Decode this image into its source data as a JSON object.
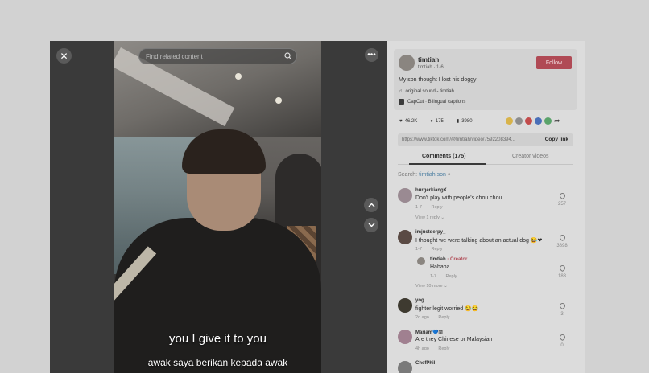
{
  "video": {
    "search_placeholder": "Find related content",
    "caption_en": "you I give it to you",
    "caption_ms": "awak saya berikan kepada awak"
  },
  "author": {
    "username": "timtiah",
    "subline": "timtiah · 1-6",
    "follow_label": "Follow",
    "description": "My son thought I lost his doggy",
    "sound": "original sound - timtiah",
    "capcut": "CapCut · Bilingual captions"
  },
  "stats": {
    "likes": "46.2K",
    "comments": "175",
    "saves": "3980"
  },
  "share_colors": [
    "#d8b34a",
    "#8d8d8d",
    "#c24b4b",
    "#4a6fb8",
    "#5aa36a",
    "#444444"
  ],
  "link": {
    "url": "https://www.tiktok.com/@timtiah/video/75922083​94...",
    "copy_label": "Copy link"
  },
  "tabs": {
    "comments": "Comments (175)",
    "creator": "Creator videos"
  },
  "search": {
    "label": "Search:",
    "query": "timtiah son"
  },
  "comments": [
    {
      "name": "burgerkiangX",
      "text": "Don't play with people's chou chou",
      "date": "1-7",
      "reply": "Reply",
      "likes": "257",
      "more": "View 1 reply"
    },
    {
      "name": "imjustderpy_",
      "text": "I thought we were talking about an actual dog 😂❤",
      "date": "1-7",
      "reply": "Reply",
      "likes": "3898"
    },
    {
      "name": "timtiah",
      "creator_tag": "· Creator",
      "text": "Hahaha",
      "date": "1-7",
      "reply": "Reply",
      "likes": "183",
      "more": "View 10 more"
    },
    {
      "name": "yog",
      "text": "fighter legit worried 😂😂",
      "date": "2d ago",
      "reply": "Reply",
      "likes": "3"
    },
    {
      "name": "Mariam💙🇲",
      "text": "Are they Chinese or Malaysian",
      "date": "4h ago",
      "reply": "Reply",
      "likes": "0"
    },
    {
      "name": "ChefPhil"
    }
  ]
}
